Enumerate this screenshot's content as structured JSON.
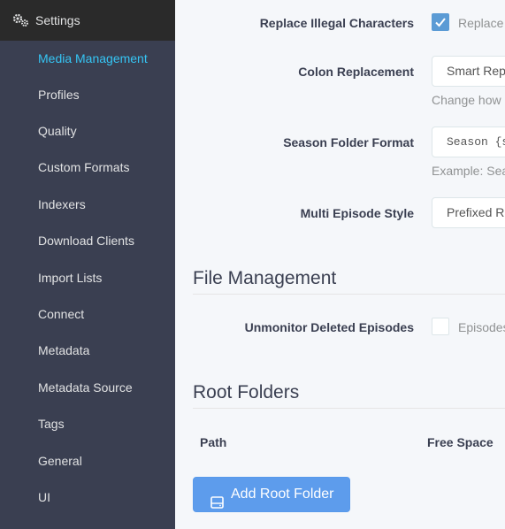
{
  "sidebar": {
    "header": {
      "title": "Settings",
      "icon": "gears-icon"
    },
    "items": [
      {
        "label": "Media Management",
        "active": true
      },
      {
        "label": "Profiles"
      },
      {
        "label": "Quality"
      },
      {
        "label": "Custom Formats"
      },
      {
        "label": "Indexers"
      },
      {
        "label": "Download Clients"
      },
      {
        "label": "Import Lists"
      },
      {
        "label": "Connect"
      },
      {
        "label": "Metadata"
      },
      {
        "label": "Metadata Source"
      },
      {
        "label": "Tags"
      },
      {
        "label": "General"
      },
      {
        "label": "UI"
      }
    ],
    "active_color": "#35c5f4"
  },
  "episode_naming": {
    "replace_illegal": {
      "label": "Replace Illegal Characters",
      "checked": true,
      "text": "Replace"
    },
    "colon_replacement": {
      "label": "Colon Replacement",
      "value": "Smart Rep",
      "help": "Change how S"
    },
    "season_folder": {
      "label": "Season Folder Format",
      "value": "Season {se",
      "help": "Example: Sea"
    },
    "multi_episode": {
      "label": "Multi Episode Style",
      "value": "Prefixed Ra"
    }
  },
  "file_management": {
    "title": "File Management",
    "unmonitor_deleted": {
      "label": "Unmonitor Deleted Episodes",
      "checked": false,
      "text": "Episodes"
    }
  },
  "root_folders": {
    "title": "Root Folders",
    "columns": [
      "Path",
      "Free Space"
    ],
    "add_button": {
      "label": "Add Root Folder",
      "icon": "drive-icon"
    }
  },
  "colors": {
    "accent": "#5d9cec",
    "sidebar_bg": "#3a3f51",
    "header_bg": "#2a2a2a"
  }
}
